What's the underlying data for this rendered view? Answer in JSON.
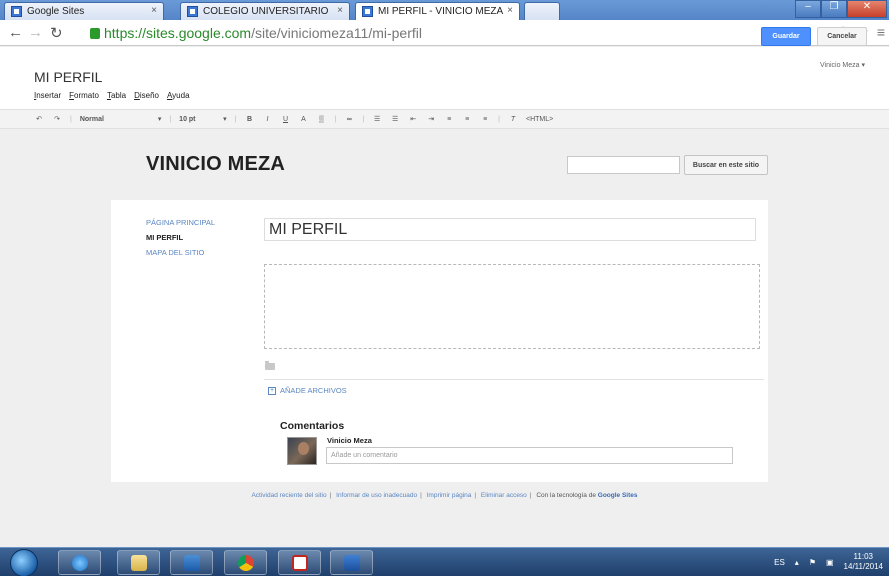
{
  "browser": {
    "tabs": [
      {
        "title": "Google Sites",
        "active": false,
        "has_close": false
      },
      {
        "title": "COLEGIO UNIVERSITARIO",
        "active": false,
        "has_close": true
      },
      {
        "title": "MI PERFIL - VINICIO MEZA",
        "active": true,
        "has_close": true
      }
    ],
    "url_secure_part": "https://sites.google.com",
    "url_path": "/site/viniciomeza11/mi-perfil"
  },
  "editor": {
    "page_title": "MI PERFIL",
    "user": "Vinicio Meza ▾",
    "save_label": "Guardar",
    "cancel_label": "Cancelar",
    "menu": [
      "Insertar",
      "Formato",
      "Tabla",
      "Diseño",
      "Ayuda"
    ],
    "toolbar": {
      "style": "Normal",
      "size": "10 pt",
      "html": "<HTML>"
    }
  },
  "site": {
    "name": "VINICIO MEZA",
    "search_button": "Buscar en este sitio",
    "nav": [
      {
        "label": "PÁGINA PRINCIPAL",
        "current": false
      },
      {
        "label": "MI PERFIL",
        "current": true
      },
      {
        "label": "MAPA DEL SITIO",
        "current": false
      }
    ],
    "title_field": "MI PERFIL",
    "attach_label": "AÑADE ARCHIVOS",
    "comments": {
      "heading": "Comentarios",
      "author": "Vinicio Meza",
      "placeholder": "Añade un comentario"
    },
    "footer": {
      "links": [
        "Actividad reciente del sitio",
        "Informar de uso inadecuado",
        "Imprimir página",
        "Eliminar acceso"
      ],
      "powered_by": "Con la tecnología de",
      "brand": "Google Sites"
    }
  },
  "taskbar": {
    "lang": "ES",
    "time": "11:03",
    "date": "14/11/2014"
  }
}
